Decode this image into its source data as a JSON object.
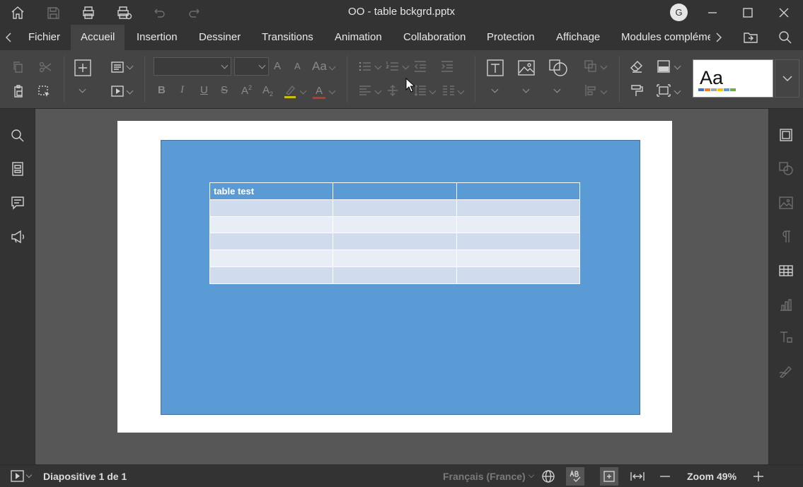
{
  "window": {
    "title": "OO - table bckgrd.pptx",
    "user_initial": "G"
  },
  "tabs": [
    {
      "label": "Fichier"
    },
    {
      "label": "Accueil",
      "active": true
    },
    {
      "label": "Insertion"
    },
    {
      "label": "Dessiner"
    },
    {
      "label": "Transitions"
    },
    {
      "label": "Animation"
    },
    {
      "label": "Collaboration"
    },
    {
      "label": "Protection"
    },
    {
      "label": "Affichage"
    },
    {
      "label": "Modules compléme"
    }
  ],
  "ribbon": {
    "font_name": "",
    "font_size": "",
    "font_grow": "A",
    "font_shrink": "A",
    "change_case": "Aa",
    "bold": "B",
    "italic": "I",
    "underline": "U",
    "strikethrough": "S",
    "superscript": "A",
    "subscript": "A",
    "font_color": "A",
    "theme_preview": "Aa",
    "theme_colors": [
      "#4472c4",
      "#ed7d31",
      "#a5a5a5",
      "#ffc000",
      "#5b9bd5",
      "#70ad47"
    ]
  },
  "slide": {
    "background_color": "#5b9bd5",
    "table": {
      "header": [
        "table test",
        "",
        ""
      ],
      "rows": [
        [
          "",
          "",
          ""
        ],
        [
          "",
          "",
          ""
        ],
        [
          "",
          "",
          ""
        ],
        [
          "",
          "",
          ""
        ],
        [
          "",
          "",
          ""
        ]
      ]
    }
  },
  "statusbar": {
    "slide_info": "Diapositive 1 de 1",
    "language": "Français (France)",
    "zoom": "Zoom 49%"
  }
}
